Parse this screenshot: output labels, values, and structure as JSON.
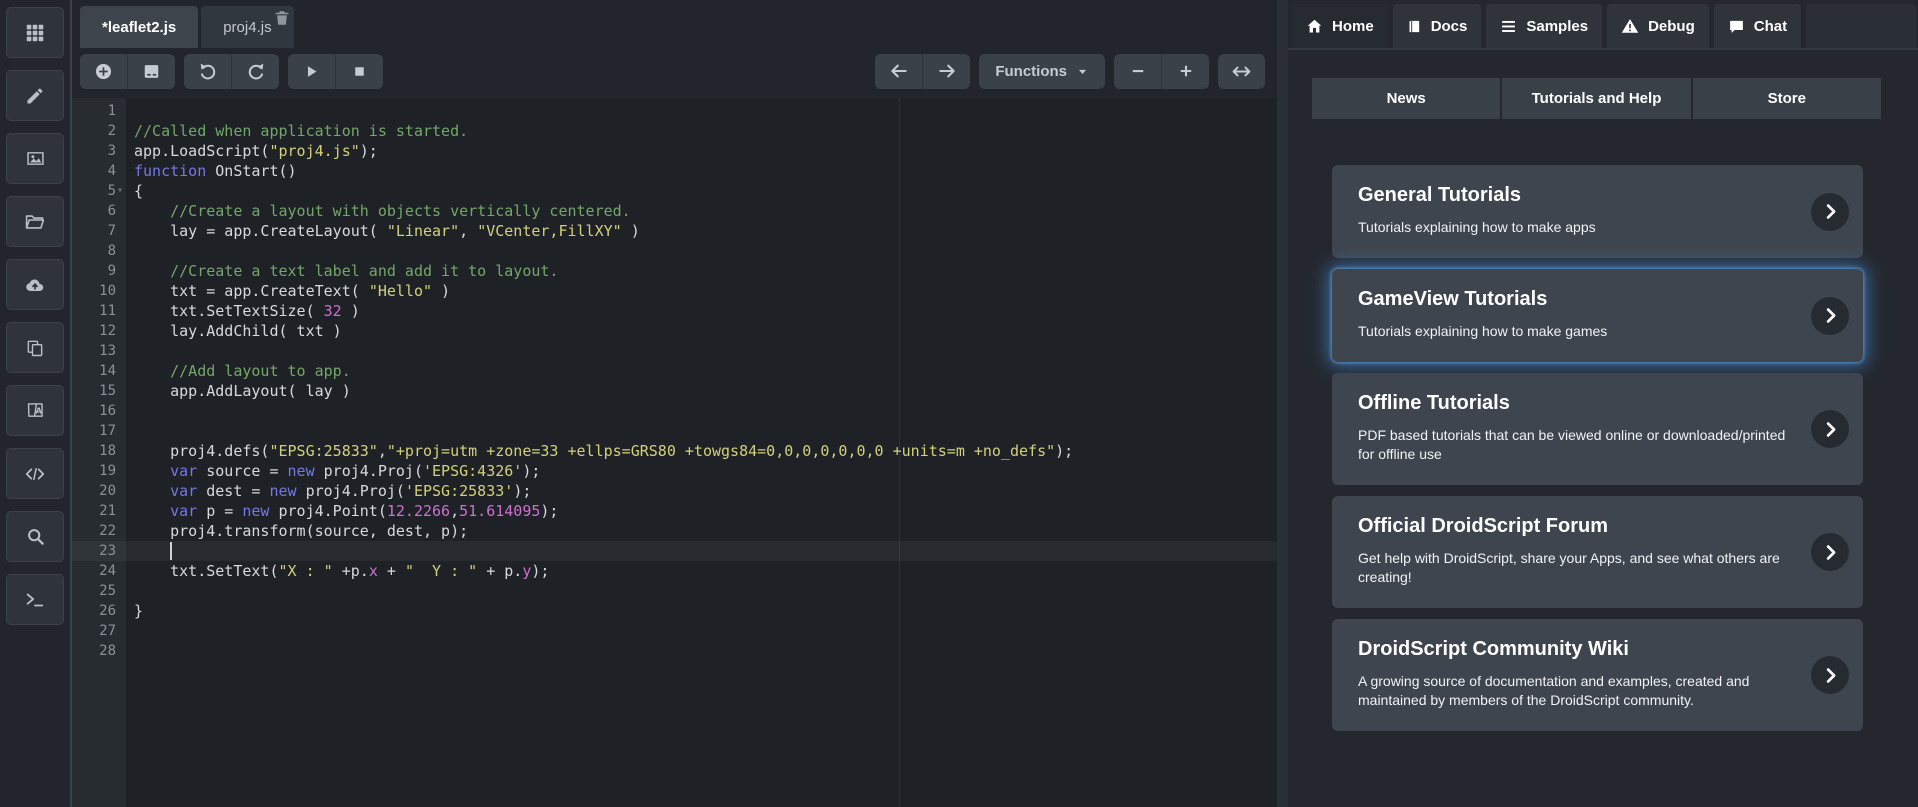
{
  "colors": {
    "comment": "#73a668",
    "keyword": "#7577e6",
    "string": "#d3d07c",
    "number": "#cf6fd0",
    "selection_glow": "#4da3ff"
  },
  "sidebar": {
    "items": [
      {
        "name": "apps",
        "icon": "apps-grid"
      },
      {
        "name": "edit",
        "icon": "pencil"
      },
      {
        "name": "media",
        "icon": "image"
      },
      {
        "name": "open-project",
        "icon": "folder-open"
      },
      {
        "name": "cloud-sync",
        "icon": "cloud-upload"
      },
      {
        "name": "duplicate",
        "icon": "copy"
      },
      {
        "name": "translate",
        "icon": "translate"
      },
      {
        "name": "code-view",
        "icon": "code"
      },
      {
        "name": "search",
        "icon": "search"
      },
      {
        "name": "terminal",
        "icon": "terminal"
      }
    ]
  },
  "editor": {
    "tabs": [
      {
        "label": "*leaflet2.js",
        "active": true,
        "trash_icon": false
      },
      {
        "label": "proj4.js",
        "active": false,
        "trash_icon": true
      }
    ],
    "toolbar": {
      "functions_label": "Functions",
      "left_groups": [
        [
          {
            "name": "add",
            "icon": "add-circle"
          },
          {
            "name": "save",
            "icon": "save"
          }
        ],
        [
          {
            "name": "undo",
            "icon": "undo"
          },
          {
            "name": "redo",
            "icon": "redo"
          }
        ],
        [
          {
            "name": "run",
            "icon": "play"
          },
          {
            "name": "stop",
            "icon": "stop"
          }
        ]
      ],
      "right_groups": [
        [
          {
            "name": "back",
            "icon": "arrow-left"
          },
          {
            "name": "forward",
            "icon": "arrow-right"
          }
        ],
        [
          {
            "name": "functions",
            "icon": "caret-down",
            "type": "dropdown",
            "label": "Functions"
          }
        ],
        [
          {
            "name": "zoom-out",
            "icon": "minus"
          },
          {
            "name": "zoom-in",
            "icon": "plus"
          }
        ],
        [
          {
            "name": "fit-width",
            "icon": "arrows-h"
          }
        ]
      ]
    },
    "code": {
      "cursor_line": 23,
      "fold_lines": [
        5
      ],
      "lines": [
        [],
        [
          [
            "cm",
            "//Called when application is started."
          ]
        ],
        [
          [
            "tx",
            "app.LoadScript("
          ],
          [
            "st",
            "\"proj4.js\""
          ],
          [
            "tx",
            ");"
          ]
        ],
        [
          [
            "kw",
            "function"
          ],
          [
            "tx",
            " OnStart()"
          ]
        ],
        [
          [
            "tx",
            "{"
          ]
        ],
        [
          [
            "cm",
            "    //Create a layout with objects vertically centered."
          ]
        ],
        [
          [
            "tx",
            "    lay = app.CreateLayout( "
          ],
          [
            "st",
            "\"Linear\""
          ],
          [
            "tx",
            ", "
          ],
          [
            "st",
            "\"VCenter,FillXY\""
          ],
          [
            "tx",
            " )"
          ]
        ],
        [],
        [
          [
            "cm",
            "    //Create a text label and add it to layout."
          ]
        ],
        [
          [
            "tx",
            "    txt = app.CreateText( "
          ],
          [
            "st",
            "\"Hello\""
          ],
          [
            "tx",
            " )"
          ]
        ],
        [
          [
            "tx",
            "    txt.SetTextSize( "
          ],
          [
            "nu",
            "32"
          ],
          [
            "tx",
            " )"
          ]
        ],
        [
          [
            "tx",
            "    lay.AddChild( txt )"
          ]
        ],
        [],
        [
          [
            "cm",
            "    //Add layout to app."
          ]
        ],
        [
          [
            "tx",
            "    app.AddLayout( lay )"
          ]
        ],
        [],
        [],
        [
          [
            "tx",
            "    proj4.defs("
          ],
          [
            "st",
            "\"EPSG:25833\""
          ],
          [
            "tx",
            ","
          ],
          [
            "st",
            "\"+proj=utm +zone=33 +ellps=GRS80 +towgs84=0,0,0,0,0,0,0 +units=m +no_defs\""
          ],
          [
            "tx",
            ");"
          ]
        ],
        [
          [
            "tx",
            "    "
          ],
          [
            "kw",
            "var"
          ],
          [
            "tx",
            " source = "
          ],
          [
            "kw",
            "new"
          ],
          [
            "tx",
            " proj4.Proj("
          ],
          [
            "st",
            "'EPSG:4326'"
          ],
          [
            "tx",
            ");"
          ]
        ],
        [
          [
            "tx",
            "    "
          ],
          [
            "kw",
            "var"
          ],
          [
            "tx",
            " dest = "
          ],
          [
            "kw",
            "new"
          ],
          [
            "tx",
            " proj4.Proj("
          ],
          [
            "st",
            "'EPSG:25833'"
          ],
          [
            "tx",
            ");"
          ]
        ],
        [
          [
            "tx",
            "    "
          ],
          [
            "kw",
            "var"
          ],
          [
            "tx",
            " p = "
          ],
          [
            "kw",
            "new"
          ],
          [
            "tx",
            " proj4.Point("
          ],
          [
            "nu",
            "12.2266"
          ],
          [
            "tx",
            ","
          ],
          [
            "nu",
            "51.614095"
          ],
          [
            "tx",
            ");"
          ]
        ],
        [
          [
            "tx",
            "    proj4.transform(source, dest, p);"
          ]
        ],
        [],
        [
          [
            "tx",
            "    txt.SetText("
          ],
          [
            "st",
            "\"X : \""
          ],
          [
            "tx",
            " +p."
          ],
          [
            "nu",
            "x"
          ],
          [
            "tx",
            " + "
          ],
          [
            "st",
            "\"  Y : \""
          ],
          [
            "tx",
            " + p."
          ],
          [
            "nu",
            "y"
          ],
          [
            "tx",
            ");"
          ]
        ],
        [],
        [
          [
            "tx",
            "}"
          ]
        ],
        [],
        []
      ]
    }
  },
  "panel": {
    "tabs": [
      {
        "label": "Home",
        "icon": "home",
        "active": true
      },
      {
        "label": "Docs",
        "icon": "docs",
        "active": false
      },
      {
        "label": "Samples",
        "icon": "samples",
        "active": false
      },
      {
        "label": "Debug",
        "icon": "debug",
        "active": false
      },
      {
        "label": "Chat",
        "icon": "chat",
        "active": false
      }
    ],
    "subtabs": [
      "News",
      "Tutorials and Help",
      "Store"
    ],
    "cards": [
      {
        "title": "General Tutorials",
        "description": "Tutorials explaining how to make apps",
        "selected": false
      },
      {
        "title": "GameView Tutorials",
        "description": "Tutorials explaining how to make games",
        "selected": true
      },
      {
        "title": "Offline Tutorials",
        "description": "PDF based tutorials that can be viewed online or downloaded/printed for offline use",
        "selected": false
      },
      {
        "title": "Official DroidScript Forum",
        "description": "Get help with DroidScript, share your Apps, and see what others are creating!",
        "selected": false
      },
      {
        "title": "DroidScript Community Wiki",
        "description": "A growing source of documentation and examples, created and maintained by members of the DroidScript community.",
        "selected": false
      }
    ]
  }
}
